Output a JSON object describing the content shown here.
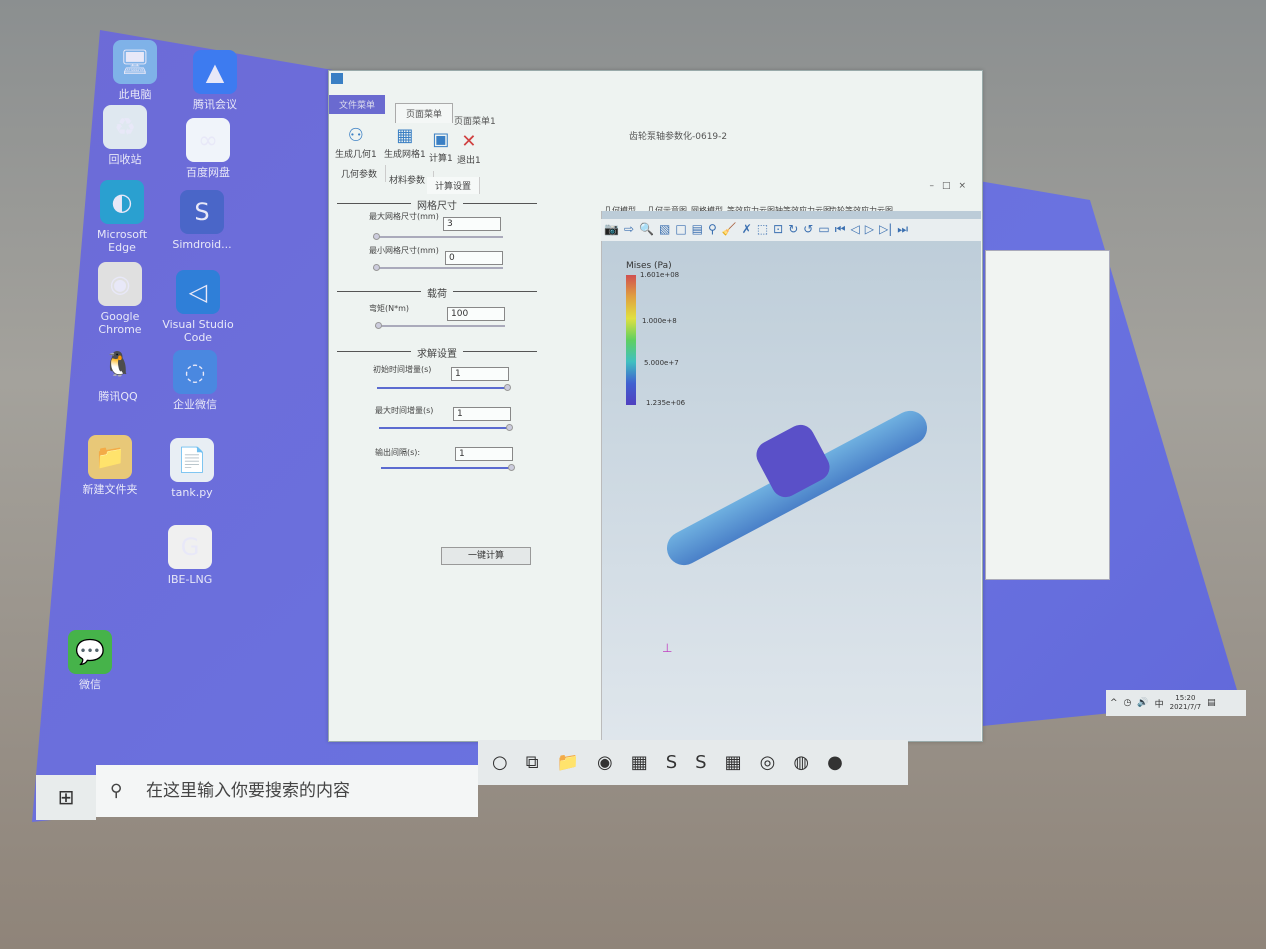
{
  "desktop": {
    "icons": [
      {
        "label": "此电脑",
        "glyph": "🖥",
        "color": "#7fb2e8"
      },
      {
        "label": "腾讯会议",
        "glyph": "▲",
        "color": "#3d7bf0"
      },
      {
        "label": "回收站",
        "glyph": "♻",
        "color": "#dfe8f0"
      },
      {
        "label": "百度网盘",
        "glyph": "∞",
        "color": "#f0f4fa"
      },
      {
        "label": "Microsoft Edge",
        "glyph": "◐",
        "color": "#2aa0d0"
      },
      {
        "label": "Simdroid...",
        "glyph": "S",
        "color": "#4a66c8"
      },
      {
        "label": "Google Chrome",
        "glyph": "◉",
        "color": "#e0e0e0"
      },
      {
        "label": "Visual Studio Code",
        "glyph": "◁",
        "color": "#2f7fd8"
      },
      {
        "label": "腾讯QQ",
        "glyph": "🐧",
        "color": "transparent"
      },
      {
        "label": "企业微信",
        "glyph": "◌",
        "color": "#4a88e0"
      },
      {
        "label": "新建文件夹",
        "glyph": "📁",
        "color": "#e8c878"
      },
      {
        "label": "tank.py",
        "glyph": "📄",
        "color": "#e8eef4"
      },
      {
        "label": "IBE-LNG",
        "glyph": "G",
        "color": "#f0f0f0"
      },
      {
        "label": "微信",
        "glyph": "💬",
        "color": "#46b34a"
      }
    ]
  },
  "app": {
    "title": "齿轮泵轴参数化-0619-2",
    "ribbon_tabs": [
      "文件菜单",
      "页面菜单",
      "页面菜单1"
    ],
    "ribbon_buttons": [
      {
        "label": "生成几何1",
        "icon": "geometry-icon"
      },
      {
        "label": "生成网格1",
        "icon": "mesh-icon"
      },
      {
        "label": "计算1",
        "icon": "compute-icon"
      },
      {
        "label": "退出1",
        "icon": "exit-icon"
      }
    ],
    "panel_tabs": [
      "几何参数",
      "材料参数",
      "计算设置"
    ],
    "sections": {
      "mesh": {
        "title": "网格尺寸",
        "fields": [
          {
            "label": "最大网格尺寸(mm)",
            "value": "3",
            "slider": 0
          },
          {
            "label": "最小网格尺寸(mm)",
            "value": "0",
            "slider": 0
          }
        ]
      },
      "load": {
        "title": "载荷",
        "fields": [
          {
            "label": "弯矩(N*m)",
            "value": "100",
            "slider": 0
          }
        ]
      },
      "solve": {
        "title": "求解设置",
        "fields": [
          {
            "label": "初始时间增量(s)",
            "value": "1",
            "slider": 100
          },
          {
            "label": "最大时间增量(s)",
            "value": "1",
            "slider": 100
          },
          {
            "label": "输出间隔(s):",
            "value": "1",
            "slider": 100
          }
        ]
      }
    },
    "run_button": "一键计算",
    "viewer_tabs": [
      "几何模型",
      "几何示意图",
      "网格模型",
      "等效应力云图",
      "轴等效应力云图",
      "齿轮等效应力云图"
    ],
    "legend": {
      "title": "Mises (Pa)",
      "ticks": [
        "1.601e+08",
        "1.000e+8",
        "5.000e+7",
        "1.235e+06"
      ]
    }
  },
  "taskbar": {
    "search_placeholder": "在这里输入你要搜索的内容",
    "time": "15:20",
    "date": "2021/7/7",
    "ime": "中"
  }
}
